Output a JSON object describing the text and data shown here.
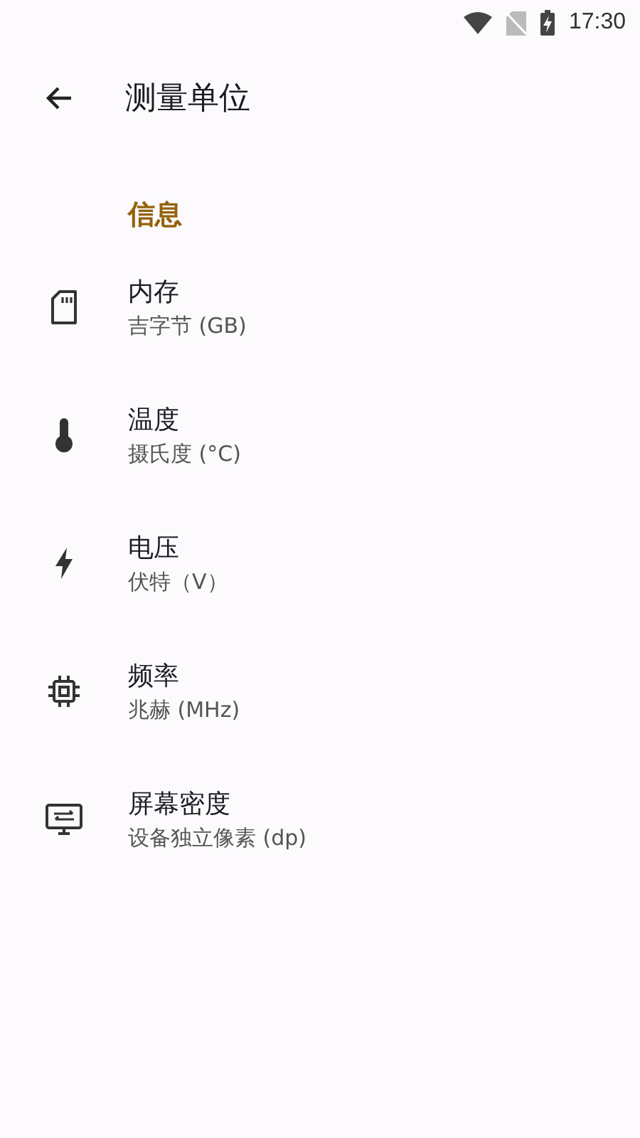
{
  "status_bar": {
    "time": "17:30"
  },
  "app_bar": {
    "title": "测量单位"
  },
  "section": {
    "title": "信息"
  },
  "items": [
    {
      "kind": "memory",
      "title": "内存",
      "summary": "吉字节 (GB)"
    },
    {
      "kind": "temperature",
      "title": "温度",
      "summary": "摄氏度 (°C)"
    },
    {
      "kind": "voltage",
      "title": "电压",
      "summary": "伏特（V）"
    },
    {
      "kind": "frequency",
      "title": "频率",
      "summary": "兆赫 (MHz)"
    },
    {
      "kind": "display",
      "title": "屏幕密度",
      "summary": "设备独立像素 (dp)"
    }
  ]
}
